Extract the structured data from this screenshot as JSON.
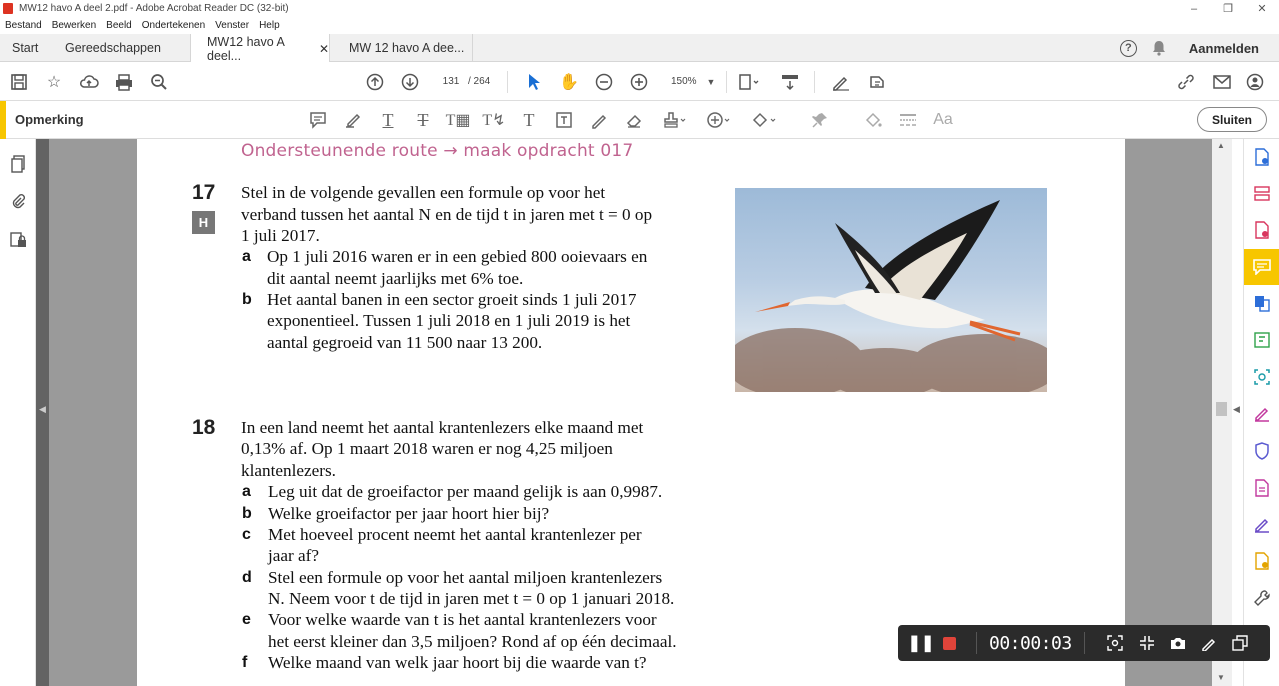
{
  "window": {
    "title": "MW12 havo A deel 2.pdf - Adobe Acrobat Reader DC (32-bit)"
  },
  "menu": [
    "Bestand",
    "Bewerken",
    "Beeld",
    "Ondertekenen",
    "Venster",
    "Help"
  ],
  "tabs": {
    "start": "Start",
    "tools": "Gereedschappen",
    "doc1": "MW12 havo A deel...",
    "doc2": "MW 12 havo A dee..."
  },
  "account": {
    "signin": "Aanmelden"
  },
  "toolbar": {
    "page_current": "131",
    "page_total": "/ 264",
    "zoom": "150%"
  },
  "comment_bar": {
    "label": "Opmerking",
    "close": "Sluiten"
  },
  "document": {
    "heading": "Ondersteunende route → maak opdracht 017",
    "q17": {
      "number": "17",
      "badge": "H",
      "intro": [
        "Stel in de volgende gevallen een formule op voor het",
        "verband tussen het aantal N en de tijd t in jaren met t = 0 op",
        "1 juli 2017."
      ],
      "a_label": "a",
      "a": [
        "Op 1 juli 2016 waren er in een gebied 800 ooievaars en",
        "dit aantal neemt jaarlijks met 6% toe."
      ],
      "b_label": "b",
      "b": [
        "Het aantal banen in een sector groeit sinds 1 juli 2017",
        "exponentieel. Tussen 1 juli 2018 en 1 juli 2019 is het",
        "aantal gegroeid van 11 500 naar 13 200."
      ]
    },
    "q18": {
      "number": "18",
      "intro": [
        "In een land neemt het aantal krantenlezers elke maand met",
        "0,13% af. Op 1 maart 2018 waren er nog 4,25 miljoen",
        "klantenlezers."
      ],
      "a_label": "a",
      "a": [
        "Leg uit dat de groeifactor per maand gelijk is aan 0,9987."
      ],
      "b_label": "b",
      "b": [
        "Welke groeifactor per jaar hoort hier bij?"
      ],
      "c_label": "c",
      "c": [
        "Met hoeveel procent neemt het aantal krantenlezer per",
        "jaar af?"
      ],
      "d_label": "d",
      "d": [
        "Stel een formule op voor het aantal miljoen krantenlezers",
        "N. Neem voor t de tijd in jaren met t = 0 op 1 januari 2018."
      ],
      "e_label": "e",
      "e": [
        "Voor welke waarde van t is het aantal krantenlezers voor",
        "het eerst kleiner dan 3,5 miljoen? Rond af op één decimaal."
      ],
      "f_label": "f",
      "f": [
        "Welke maand van welk jaar hoort bij die waarde van t?"
      ]
    }
  },
  "recorder": {
    "time": "00:00:03"
  },
  "colors": {
    "accent_yellow": "#f7c600",
    "heading_pink": "#c0638f",
    "recorder_red": "#e0443a"
  }
}
